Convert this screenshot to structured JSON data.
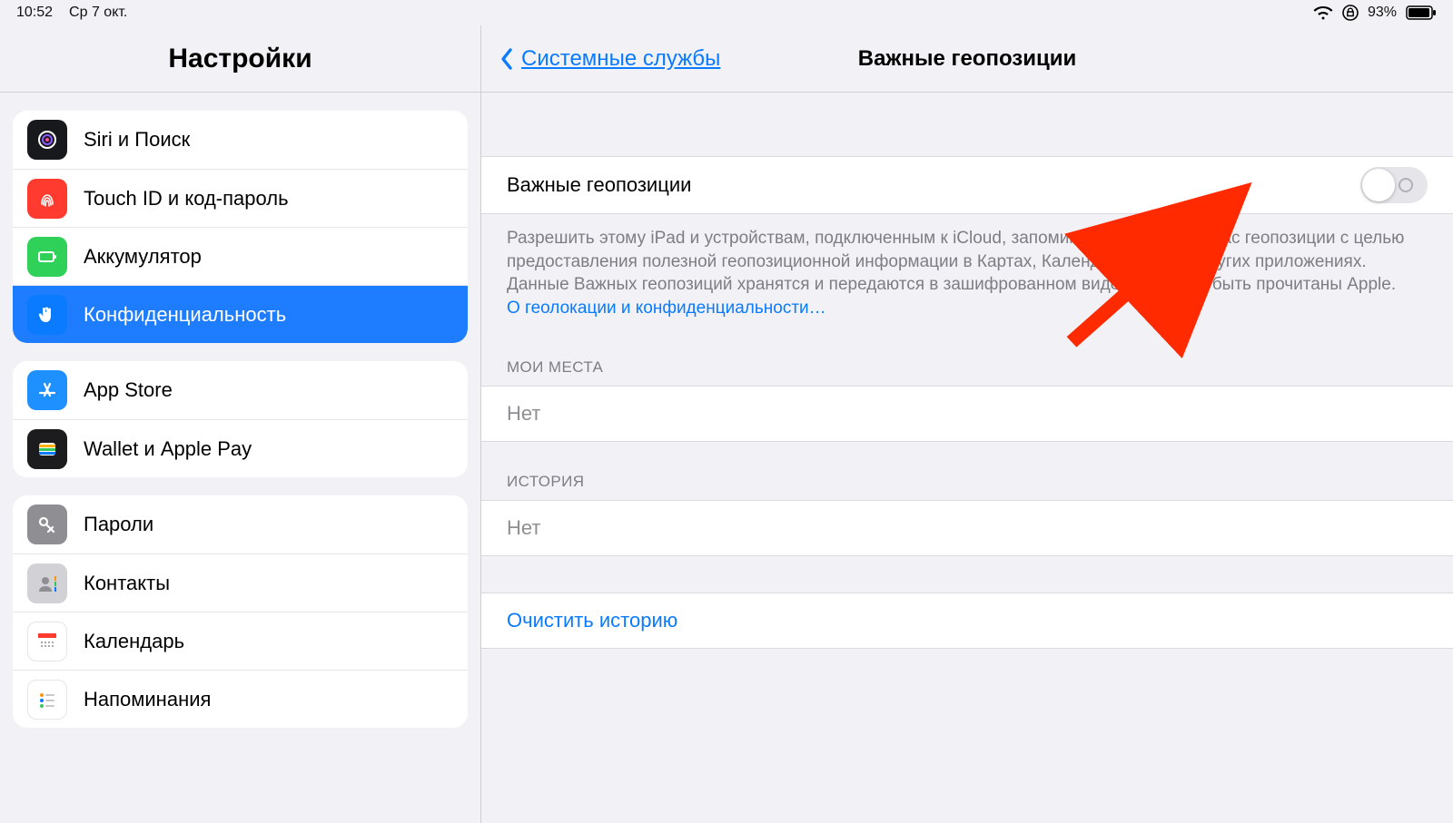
{
  "status": {
    "time": "10:52",
    "date": "Ср 7 окт.",
    "battery_pct": "93%"
  },
  "sidebar": {
    "title": "Настройки",
    "groups": [
      {
        "items": [
          {
            "id": "siri",
            "label": "Siri и Поиск",
            "icon_bg": "#17191c",
            "selected": false
          },
          {
            "id": "touchid",
            "label": "Touch ID и код-пароль",
            "icon_bg": "#ff3b30",
            "selected": false
          },
          {
            "id": "battery",
            "label": "Аккумулятор",
            "icon_bg": "#30d158",
            "selected": false
          },
          {
            "id": "privacy",
            "label": "Конфиденциальность",
            "icon_bg": "#0a7aff",
            "selected": true
          }
        ]
      },
      {
        "items": [
          {
            "id": "appstore",
            "label": "App Store",
            "icon_bg": "#1e90ff",
            "selected": false
          },
          {
            "id": "wallet",
            "label": "Wallet и Apple Pay",
            "icon_bg": "#1c1c1e",
            "selected": false
          }
        ]
      },
      {
        "items": [
          {
            "id": "passwords",
            "label": "Пароли",
            "icon_bg": "#8e8e93",
            "selected": false
          },
          {
            "id": "contacts",
            "label": "Контакты",
            "icon_bg": "#d1d1d6",
            "selected": false
          },
          {
            "id": "calendar",
            "label": "Календарь",
            "icon_bg": "#ffffff",
            "selected": false
          },
          {
            "id": "reminders",
            "label": "Напоминания",
            "icon_bg": "#ffffff",
            "selected": false
          }
        ]
      }
    ]
  },
  "detail": {
    "back_label": "Системные службы",
    "title": "Важные геопозиции",
    "toggle": {
      "label": "Важные геопозиции",
      "on": false
    },
    "description": "Разрешить этому iPad и устройствам, подключенным к iCloud, запоминать важные для Вас геопозиции с целью предоставления полезной геопозиционной информации в Картах, Календаре, Фото и других приложениях. Данные Важных геопозиций хранятся и передаются в зашифрованном виде и не могут быть прочитаны Apple.",
    "more_link": "О геолокации и конфиденциальности…",
    "sections": {
      "places": {
        "header": "МОИ МЕСТА",
        "value": "Нет"
      },
      "history": {
        "header": "ИСТОРИЯ",
        "value": "Нет"
      }
    },
    "clear_label": "Очистить историю"
  }
}
